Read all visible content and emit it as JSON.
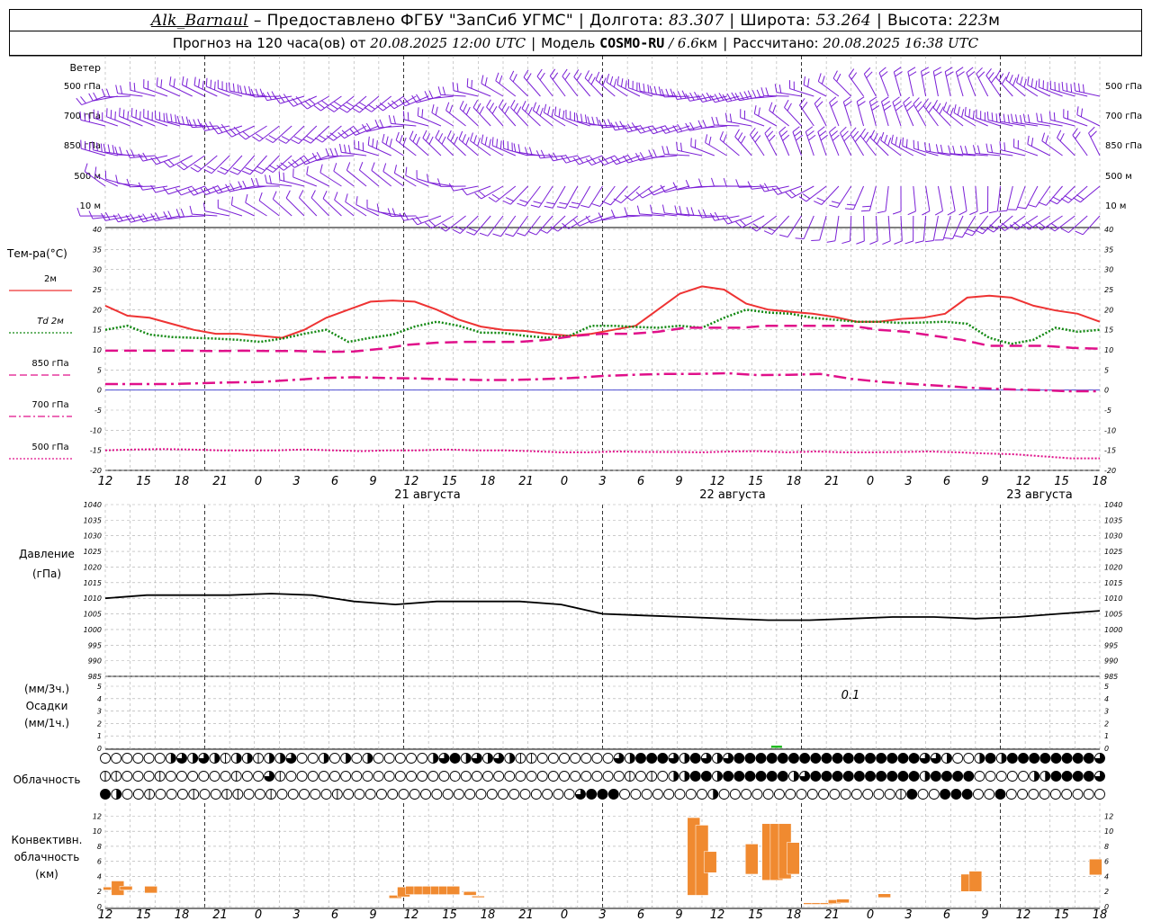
{
  "header": {
    "station": "Alk_Barnaul",
    "provider": "Предоставлено ФГБУ \"ЗапСиб УГМС\"",
    "lon_label": "Долгота:",
    "lon": "83.307",
    "lat_label": "Широта:",
    "lat": "53.264",
    "alt_label": "Высота:",
    "alt": "223",
    "alt_unit": "м",
    "forecast_prefix": "Прогноз на 120 часа(ов) от",
    "forecast_time": "20.08.2025 12:00 UTC",
    "model_label": "Модель",
    "model": "COSMO-RU",
    "model_res": "/ 6.6",
    "model_res_unit": "км",
    "calc_label": "Рассчитано:",
    "calc_time": "20.08.2025 16:38 UTC"
  },
  "wind_panel": {
    "title": "Ветер",
    "levels": [
      "500 гПа",
      "700 гПа",
      "850 гПа",
      "500 м",
      "10  м"
    ]
  },
  "hour_labels": [
    "12",
    "15",
    "18",
    "21",
    "0",
    "3",
    "6",
    "9",
    "12",
    "15",
    "18",
    "21",
    "0",
    "3",
    "6",
    "9",
    "12",
    "15",
    "18",
    "21",
    "0",
    "3",
    "6",
    "9",
    "12",
    "15",
    "18"
  ],
  "day_labels": [
    "21 августа",
    "22 августа",
    "23 августа"
  ],
  "colors": {
    "t2m": "#ee3333",
    "td2m": "#118811",
    "t850": "#e0108a",
    "wind": "#7a1fd6",
    "convective": "#f08a30",
    "precip": "#22bb22",
    "zero_line": "#3333cc"
  },
  "chart_data": [
    {
      "type": "line",
      "panel": "temperature",
      "ylabel": "Тем-ра(°C)",
      "ylim": [
        -20,
        40
      ],
      "yticks": [
        -20,
        -15,
        -10,
        -5,
        0,
        5,
        10,
        15,
        20,
        25,
        30,
        35,
        40
      ],
      "x_hours_from_start": [
        0,
        3,
        6,
        9,
        12,
        15,
        18,
        21,
        24,
        27,
        30,
        33,
        36,
        39,
        42,
        45,
        48,
        51,
        54,
        57,
        60,
        63,
        66,
        69,
        72,
        75,
        78,
        81,
        84,
        87,
        90,
        93,
        96,
        99,
        102,
        105,
        108,
        111,
        114,
        117,
        120
      ],
      "series": [
        {
          "name": "2м",
          "style": "solid",
          "values": [
            21,
            18.5,
            18,
            16.5,
            15,
            14,
            14,
            13.5,
            13,
            15,
            18,
            20,
            22,
            22.3,
            22,
            20,
            17.5,
            15.8,
            15,
            14.7,
            14,
            13.5,
            14,
            15,
            16,
            20,
            24,
            25.8,
            25,
            21.5,
            20,
            19.5,
            19,
            18.2,
            17,
            17,
            17.7,
            18,
            19,
            23,
            23.5,
            23,
            21,
            19.8,
            19,
            17
          ]
        },
        {
          "name": "Td 2м",
          "style": "dotted",
          "values": [
            15,
            16,
            13.8,
            13.2,
            13,
            12.8,
            12.5,
            12,
            12.8,
            14,
            15,
            12,
            13,
            13.8,
            15.8,
            17,
            16,
            14.3,
            14.2,
            13.5,
            13,
            13.5,
            16,
            16,
            15.7,
            15.5,
            16,
            15.5,
            18,
            20,
            19.3,
            19,
            18,
            17.5,
            17,
            17,
            16.7,
            16.8,
            17,
            16.5,
            13,
            11.5,
            12.5,
            15.5,
            14.5,
            15
          ]
        },
        {
          "name": "850 гПа",
          "style": "dashed",
          "values": [
            9.8,
            9.8,
            9.8,
            9.8,
            9.7,
            9.8,
            9.7,
            9.7,
            9.5,
            9.6,
            10.3,
            11.3,
            11.8,
            12,
            12,
            12,
            12.5,
            13.5,
            14,
            14,
            14.5,
            15.5,
            15.5,
            15.5,
            16,
            16,
            16,
            16,
            15,
            14.5,
            13.5,
            12.5,
            11,
            11,
            11,
            10.5,
            10.3
          ]
        },
        {
          "name": "700 гПа",
          "style": "dashdot",
          "values": [
            1.5,
            1.5,
            1.5,
            1.7,
            1.9,
            2,
            2.5,
            3,
            3.2,
            3,
            2.9,
            2.7,
            2.5,
            2.5,
            2.7,
            3,
            3.5,
            3.8,
            4,
            4,
            4.2,
            3.7,
            3.8,
            4,
            2.8,
            2,
            1.5,
            1,
            0.5,
            0.2,
            0,
            -0.3,
            -0.3
          ]
        },
        {
          "name": "500 гПа",
          "style": "dotted",
          "values": [
            -15,
            -14.8,
            -14.7,
            -14.8,
            -15,
            -15,
            -15,
            -14.8,
            -15,
            -15.2,
            -15,
            -15,
            -14.8,
            -15,
            -15,
            -15.2,
            -15.5,
            -15.5,
            -15.3,
            -15.4,
            -15.4,
            -15.5,
            -15.3,
            -15.2,
            -15.5,
            -15.3,
            -15.5,
            -15.5,
            -15.4,
            -15.3,
            -15.5,
            -15.8,
            -16,
            -16.5,
            -17,
            -17
          ]
        }
      ]
    },
    {
      "type": "line",
      "panel": "pressure",
      "ylabel": "Давление (гПа)",
      "ylim": [
        985,
        1040
      ],
      "yticks": [
        985,
        990,
        995,
        1000,
        1005,
        1010,
        1015,
        1020,
        1025,
        1030,
        1035,
        1040
      ],
      "x_hours_from_start": [
        0,
        6,
        12,
        18,
        24,
        30,
        36,
        42,
        48,
        54,
        60,
        66,
        72,
        78,
        84,
        90,
        96,
        102,
        108,
        114,
        120
      ],
      "series": [
        {
          "name": "Давление",
          "values": [
            1010,
            1011,
            1011,
            1011,
            1011.5,
            1011,
            1009,
            1008,
            1009,
            1009,
            1009,
            1008,
            1005,
            1004.5,
            1004,
            1003.5,
            1003,
            1003,
            1003.5,
            1004,
            1004,
            1003.5,
            1004,
            1005,
            1006
          ]
        }
      ]
    },
    {
      "type": "bar",
      "panel": "precipitation",
      "ylabel": "(мм/3ч.) Осадки (мм/1ч.)",
      "ylim": [
        0,
        5
      ],
      "yticks": [
        0,
        1,
        2,
        3,
        4,
        5
      ],
      "annotation": "0.1",
      "bars": [
        {
          "hour_from_start": 81,
          "value": 0.1
        }
      ]
    },
    {
      "type": "table",
      "panel": "cloud_cover",
      "ylabel": "Облачность",
      "rows_octas": [
        [
          0,
          0,
          0,
          0,
          0,
          0,
          4,
          6,
          4,
          6,
          4,
          2,
          4,
          4,
          2,
          4,
          4,
          6,
          0,
          0,
          4,
          0,
          4,
          0,
          4,
          0,
          0,
          0,
          0,
          0,
          4,
          6,
          8,
          4,
          6,
          4,
          6,
          4,
          2,
          2,
          0,
          0,
          0,
          0,
          0,
          0,
          0,
          6,
          4,
          8,
          8,
          8,
          6,
          4,
          8,
          6,
          4,
          6,
          8,
          8,
          8,
          8,
          8,
          8,
          8,
          8,
          8,
          8,
          8,
          8,
          8,
          8,
          8,
          8,
          8,
          6,
          6,
          4,
          0,
          0,
          4,
          8,
          4,
          8,
          8,
          8,
          8,
          8,
          8,
          8,
          8,
          6
        ],
        [
          2,
          2,
          0,
          0,
          0,
          2,
          0,
          0,
          0,
          0,
          0,
          0,
          2,
          0,
          0,
          6,
          2,
          0,
          0,
          0,
          0,
          0,
          0,
          0,
          0,
          0,
          0,
          0,
          0,
          0,
          0,
          0,
          0,
          0,
          0,
          0,
          0,
          0,
          0,
          0,
          0,
          0,
          0,
          0,
          0,
          0,
          0,
          0,
          2,
          0,
          2,
          0,
          4,
          4,
          8,
          8,
          4,
          8,
          8,
          8,
          8,
          8,
          8,
          4,
          6,
          8,
          8,
          8,
          8,
          8,
          8,
          8,
          8,
          8,
          8,
          4,
          8,
          8,
          8,
          8,
          0,
          0,
          0,
          0,
          0,
          4,
          4,
          8,
          8,
          8,
          8,
          6
        ],
        [
          8,
          4,
          0,
          0,
          2,
          0,
          0,
          0,
          2,
          0,
          0,
          2,
          2,
          0,
          0,
          2,
          0,
          0,
          0,
          0,
          0,
          2,
          0,
          0,
          0,
          0,
          0,
          0,
          0,
          0,
          0,
          0,
          0,
          0,
          0,
          0,
          0,
          0,
          0,
          0,
          0,
          0,
          0,
          6,
          8,
          8,
          8,
          0,
          0,
          0,
          0,
          0,
          0,
          0,
          0,
          4,
          0,
          0,
          0,
          0,
          0,
          0,
          0,
          0,
          0,
          0,
          0,
          0,
          0,
          0,
          0,
          0,
          2,
          8,
          0,
          0,
          8,
          8,
          8,
          0,
          0,
          8,
          0,
          0,
          0,
          0,
          0,
          0,
          0,
          0,
          0
        ]
      ]
    },
    {
      "type": "bar",
      "panel": "convective_cloud",
      "ylabel": "Конвективн. облачность (км)",
      "ylim": [
        0,
        13
      ],
      "yticks": [
        0,
        2,
        4,
        6,
        8,
        10,
        12
      ],
      "bars": [
        {
          "hour_from_start": 0.5,
          "base": 2.2,
          "top": 2.6
        },
        {
          "hour_from_start": 1.5,
          "base": 1.5,
          "top": 3.4
        },
        {
          "hour_from_start": 2.5,
          "base": 2.2,
          "top": 2.7
        },
        {
          "hour_from_start": 5.5,
          "base": 1.8,
          "top": 2.7
        },
        {
          "hour_from_start": 35,
          "base": 1.1,
          "top": 1.5
        },
        {
          "hour_from_start": 36,
          "base": 1.3,
          "top": 2.6
        },
        {
          "hour_from_start": 37,
          "base": 1.6,
          "top": 2.7
        },
        {
          "hour_from_start": 38,
          "base": 1.6,
          "top": 2.7
        },
        {
          "hour_from_start": 39,
          "base": 1.6,
          "top": 2.7
        },
        {
          "hour_from_start": 40,
          "base": 1.6,
          "top": 2.7
        },
        {
          "hour_from_start": 41,
          "base": 1.6,
          "top": 2.7
        },
        {
          "hour_from_start": 42,
          "base": 1.6,
          "top": 2.7
        },
        {
          "hour_from_start": 44,
          "base": 1.5,
          "top": 2.0
        },
        {
          "hour_from_start": 45,
          "base": 1.2,
          "top": 1.4
        },
        {
          "hour_from_start": 71,
          "base": 1.5,
          "top": 11.8
        },
        {
          "hour_from_start": 72,
          "base": 1.5,
          "top": 10.8
        },
        {
          "hour_from_start": 73,
          "base": 4.5,
          "top": 7.3
        },
        {
          "hour_from_start": 78,
          "base": 4.3,
          "top": 8.3
        },
        {
          "hour_from_start": 80,
          "base": 3.5,
          "top": 11
        },
        {
          "hour_from_start": 81,
          "base": 3.5,
          "top": 11
        },
        {
          "hour_from_start": 82,
          "base": 3.7,
          "top": 11
        },
        {
          "hour_from_start": 83,
          "base": 4.3,
          "top": 8.5
        },
        {
          "hour_from_start": 85,
          "base": 0.3,
          "top": 0.5
        },
        {
          "hour_from_start": 86,
          "base": 0.3,
          "top": 0.5
        },
        {
          "hour_from_start": 87,
          "base": 0.3,
          "top": 0.5
        },
        {
          "hour_from_start": 88,
          "base": 0.4,
          "top": 0.9
        },
        {
          "hour_from_start": 89,
          "base": 0.5,
          "top": 1.0
        },
        {
          "hour_from_start": 94,
          "base": 1.2,
          "top": 1.7
        },
        {
          "hour_from_start": 104,
          "base": 2.0,
          "top": 4.3
        },
        {
          "hour_from_start": 105,
          "base": 2.0,
          "top": 4.7
        },
        {
          "hour_from_start": 119.5,
          "base": 4.2,
          "top": 6.3
        }
      ]
    },
    {
      "type": "scatter",
      "panel": "wind",
      "note": "wind barbs at 5 levels",
      "levels": [
        "500 гПа",
        "700 гПа",
        "850 гПа",
        "500 м",
        "10  м"
      ]
    }
  ]
}
